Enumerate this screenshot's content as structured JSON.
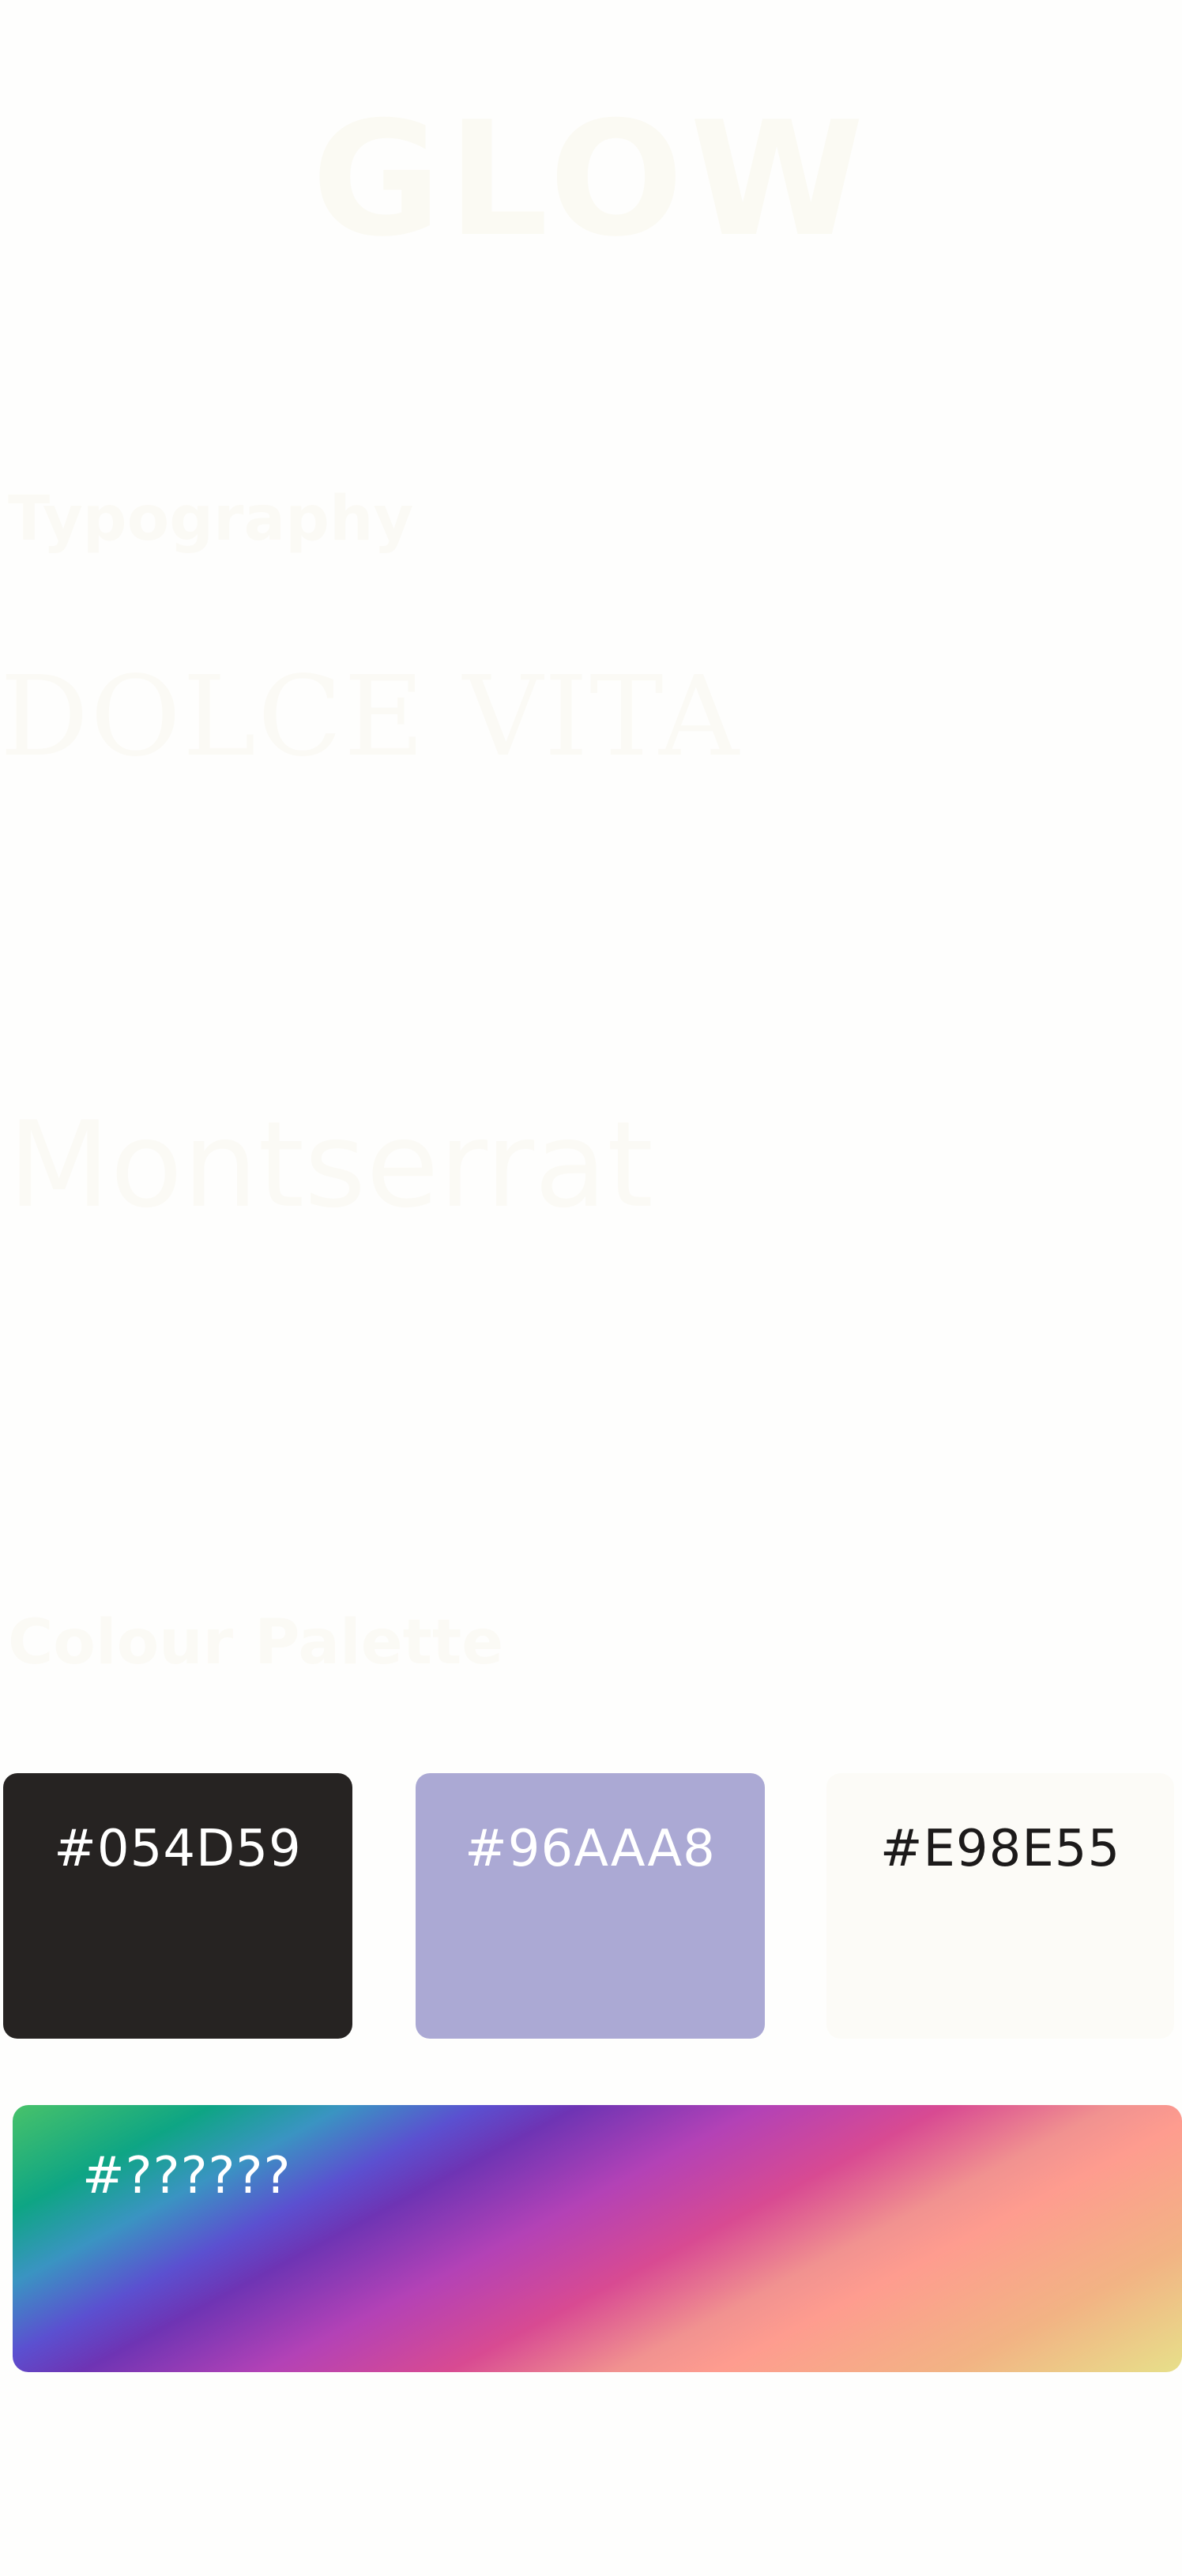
{
  "header": {
    "logo_text": "GLOW"
  },
  "typography": {
    "heading": "Typography",
    "fonts": [
      {
        "name": "DOLCE VITA"
      },
      {
        "name": "Montserrat"
      }
    ]
  },
  "palette": {
    "heading": "Colour Palette",
    "swatches": [
      {
        "label": "#054D59",
        "color": "#262322",
        "text_color": "#ffffff"
      },
      {
        "label": "#96AAA8",
        "color": "#aba9d4",
        "text_color": "#ffffff"
      },
      {
        "label": "#E98E55",
        "color": "#fcfbf7",
        "text_color": "#1c1a1a"
      }
    ],
    "gradient": {
      "label": "#??????",
      "text_color": "#ffffff"
    }
  }
}
